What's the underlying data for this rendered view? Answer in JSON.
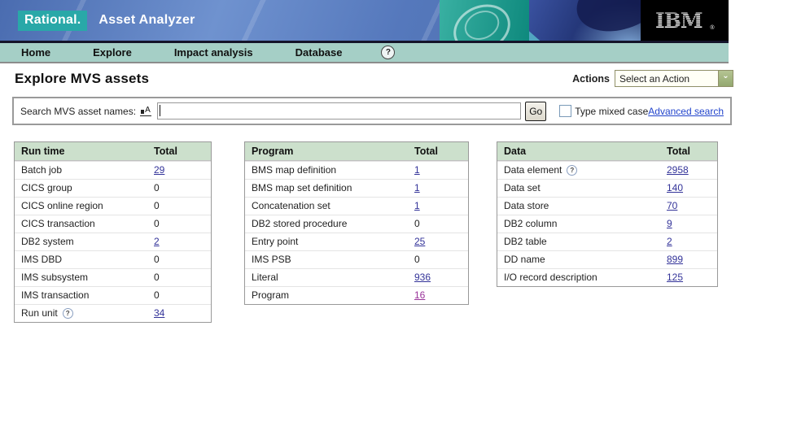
{
  "banner": {
    "brand": "Rational.",
    "product": "Asset Analyzer",
    "ibm_logo": "IBM",
    "ibm_reg": "®"
  },
  "nav": {
    "items": [
      {
        "id": "home",
        "label": "Home"
      },
      {
        "id": "explore",
        "label": "Explore"
      },
      {
        "id": "impact-analysis",
        "label": "Impact analysis"
      },
      {
        "id": "database",
        "label": "Database"
      }
    ],
    "help_glyph": "?"
  },
  "page": {
    "title": "Explore MVS assets"
  },
  "actions": {
    "label": "Actions",
    "selected": "Select an Action"
  },
  "search": {
    "label": "Search MVS asset names:",
    "case_glyph": "A",
    "value": "",
    "go_label": "Go",
    "checkbox_label": "Type mixed case",
    "checkbox_checked": false,
    "advanced_link": "Advanced search"
  },
  "tables": [
    {
      "id": "run-time",
      "title": "Run time",
      "total_label": "Total",
      "rows": [
        {
          "name": "Batch job",
          "total": "29",
          "link": true
        },
        {
          "name": "CICS group",
          "total": "0",
          "link": false
        },
        {
          "name": "CICS online region",
          "total": "0",
          "link": false
        },
        {
          "name": "CICS transaction",
          "total": "0",
          "link": false
        },
        {
          "name": "DB2 system",
          "total": "2",
          "link": true
        },
        {
          "name": "IMS DBD",
          "total": "0",
          "link": false
        },
        {
          "name": "IMS subsystem",
          "total": "0",
          "link": false
        },
        {
          "name": "IMS transaction",
          "total": "0",
          "link": false
        },
        {
          "name": "Run unit",
          "total": "34",
          "link": true,
          "help": true
        }
      ]
    },
    {
      "id": "program",
      "title": "Program",
      "total_label": "Total",
      "rows": [
        {
          "name": "BMS map definition",
          "total": "1",
          "link": true
        },
        {
          "name": "BMS map set definition",
          "total": "1",
          "link": true
        },
        {
          "name": "Concatenation set",
          "total": "1",
          "link": true
        },
        {
          "name": "DB2 stored procedure",
          "total": "0",
          "link": false
        },
        {
          "name": "Entry point",
          "total": "25",
          "link": true
        },
        {
          "name": "IMS PSB",
          "total": "0",
          "link": false
        },
        {
          "name": "Literal",
          "total": "936",
          "link": true
        },
        {
          "name": "Program",
          "total": "16",
          "link": true,
          "visited": true
        }
      ]
    },
    {
      "id": "data",
      "title": "Data",
      "total_label": "Total",
      "rows": [
        {
          "name": "Data element",
          "total": "2958",
          "link": true,
          "help": true
        },
        {
          "name": "Data set",
          "total": "140",
          "link": true
        },
        {
          "name": "Data store",
          "total": "70",
          "link": true
        },
        {
          "name": "DB2 column",
          "total": "9",
          "link": true
        },
        {
          "name": "DB2 table",
          "total": "2",
          "link": true
        },
        {
          "name": "DD name",
          "total": "899",
          "link": true
        },
        {
          "name": "I/O record description",
          "total": "125",
          "link": true
        }
      ]
    }
  ],
  "colors": {
    "banner_blue": "#5578bc",
    "brand_teal": "#29a8a8",
    "nav_teal": "#a5cfc6",
    "table_header_green": "#cce0cc",
    "link": "#333399",
    "visited_link": "#993399",
    "advanced_link": "#2244cc",
    "ibm_box": "#000000"
  }
}
